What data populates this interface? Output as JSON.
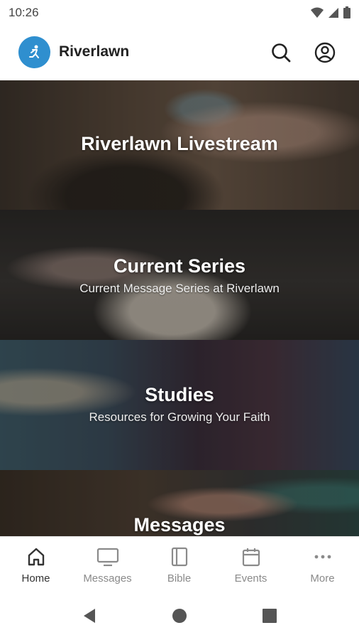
{
  "status_bar": {
    "time": "10:26"
  },
  "header": {
    "title": "Riverlawn",
    "logo_name": "runner-logo",
    "accent": "#2f8fcf"
  },
  "tiles": [
    {
      "title": "Riverlawn Livestream",
      "subtitle": ""
    },
    {
      "title": "Current Series",
      "subtitle": "Current Message Series at Riverlawn"
    },
    {
      "title": "Studies",
      "subtitle": "Resources for Growing Your Faith"
    },
    {
      "title": "Messages",
      "subtitle": ""
    }
  ],
  "nav": [
    {
      "label": "Home",
      "icon": "home-icon",
      "active": true
    },
    {
      "label": "Messages",
      "icon": "monitor-icon",
      "active": false
    },
    {
      "label": "Bible",
      "icon": "book-icon",
      "active": false
    },
    {
      "label": "Events",
      "icon": "calendar-icon",
      "active": false
    },
    {
      "label": "More",
      "icon": "more-icon",
      "active": false
    }
  ]
}
